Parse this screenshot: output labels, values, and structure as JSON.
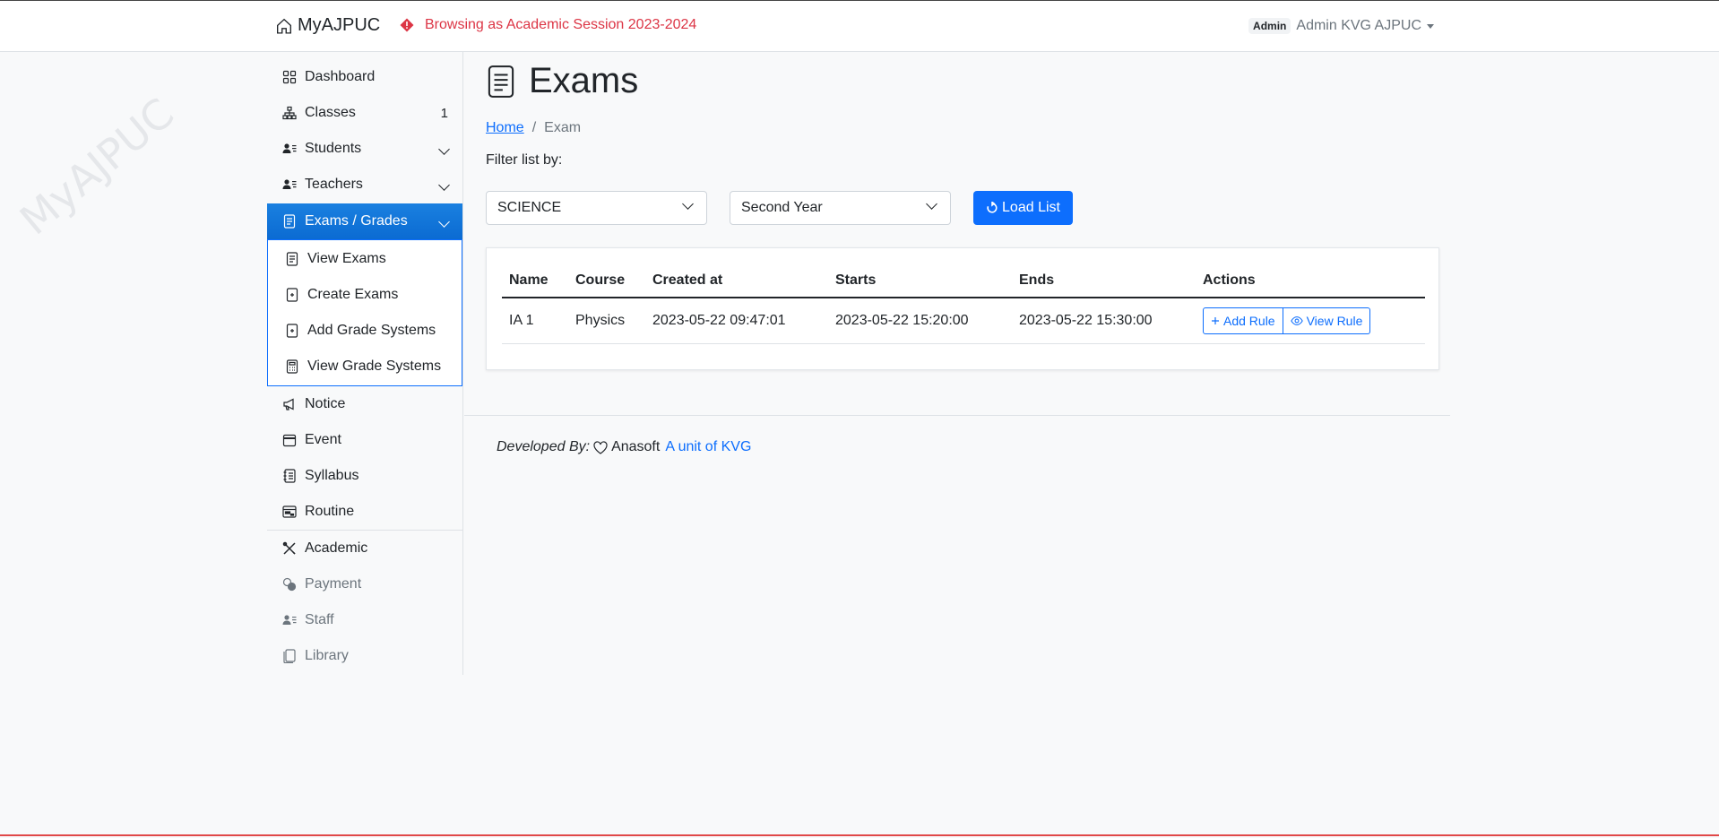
{
  "app": {
    "brand": "MyAJPUC",
    "session_notice": "Browsing as Academic Session 2023-2024",
    "user_badge": "Admin",
    "user_name": "Admin KVG AJPUC",
    "watermark": "MyAJPUC",
    "accent_color": "#0d6efd",
    "danger_color": "#dc3545"
  },
  "sidebar": {
    "items": [
      {
        "label": "Dashboard",
        "icon": "grid-icon"
      },
      {
        "label": "Classes",
        "icon": "diagram-icon",
        "count": "1"
      },
      {
        "label": "Students",
        "icon": "person-lines-icon"
      },
      {
        "label": "Teachers",
        "icon": "person-lines-icon"
      },
      {
        "label": "Exams / Grades",
        "icon": "file-text-icon",
        "active": true
      },
      {
        "label": "Notice",
        "icon": "megaphone-icon"
      },
      {
        "label": "Event",
        "icon": "calendar-icon"
      },
      {
        "label": "Syllabus",
        "icon": "journal-icon"
      },
      {
        "label": "Routine",
        "icon": "calendar-range-icon"
      },
      {
        "label": "Academic",
        "icon": "tools-icon"
      },
      {
        "label": "Payment",
        "icon": "coins-icon"
      },
      {
        "label": "Staff",
        "icon": "person-lines-icon"
      },
      {
        "label": "Library",
        "icon": "journals-icon"
      }
    ],
    "submenu": [
      {
        "label": "View Exams",
        "icon": "file-text-icon"
      },
      {
        "label": "Create Exams",
        "icon": "file-plus-icon"
      },
      {
        "label": "Add Grade Systems",
        "icon": "file-plus-icon"
      },
      {
        "label": "View Grade Systems",
        "icon": "calculator-icon"
      }
    ]
  },
  "main": {
    "title": "Exams",
    "breadcrumb": {
      "home": "Home",
      "current": "Exam"
    },
    "filter_label": "Filter list by:",
    "course_select": "SCIENCE",
    "year_select": "Second Year",
    "load_button": "Load List",
    "table": {
      "headers": [
        "Name",
        "Course",
        "Created at",
        "Starts",
        "Ends",
        "Actions"
      ],
      "rows": [
        {
          "name": "IA 1",
          "course": "Physics",
          "created": "2023-05-22 09:47:01",
          "starts": "2023-05-22 15:20:00",
          "ends": "2023-05-22 15:30:00"
        }
      ],
      "add_rule": "Add Rule",
      "view_rule": "View Rule"
    }
  },
  "footer": {
    "developed_by": "Developed By:",
    "company": "Anasoft",
    "link": "A unit of KVG"
  }
}
